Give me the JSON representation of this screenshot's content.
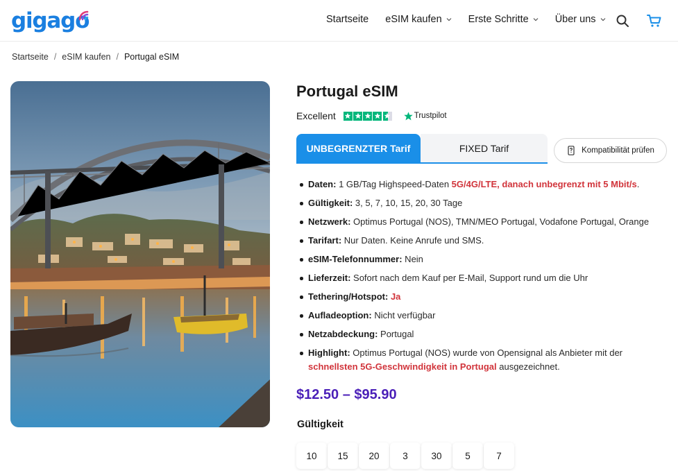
{
  "brand": {
    "logo_text": "gigago",
    "logo_color": "#1a7fe0",
    "logo_arc_colors": [
      "#e23a78",
      "#8a4fd8",
      "#2ea8e8"
    ]
  },
  "nav": {
    "items": [
      {
        "label": "Startseite",
        "has_dropdown": false
      },
      {
        "label": "eSIM kaufen",
        "has_dropdown": true
      },
      {
        "label": "Erste Schritte",
        "has_dropdown": true
      },
      {
        "label": "Über uns",
        "has_dropdown": true
      }
    ],
    "icons": [
      "search-icon",
      "cart-icon"
    ],
    "cart_color": "#1a8fe8"
  },
  "breadcrumb": {
    "items": [
      "Startseite",
      "eSIM kaufen",
      "Portugal eSIM"
    ],
    "separator": "/"
  },
  "product": {
    "image_alt": "Porto bridge at dusk",
    "title": "Portugal eSIM",
    "rating": {
      "word": "Excellent",
      "stars": 4.5,
      "provider": "Trustpilot",
      "star_color": "#00b67a"
    },
    "tabs": [
      {
        "label": "UNBEGRENZTER Tarif",
        "active": true
      },
      {
        "label": "FIXED Tarif",
        "active": false
      }
    ],
    "accent_color": "#1a8fe8",
    "compat_button": "Kompatibilität prüfen",
    "features": [
      {
        "key": "Daten:",
        "value": " 1 GB/Tag Highspeed-Daten ",
        "highlight": "5G/4G/LTE, danach unbegrenzt mit 5 Mbit/s",
        "tail": "."
      },
      {
        "key": "Gültigkeit:",
        "value": " 3, 5, 7, 10, 15, 20, 30 Tage",
        "highlight": "",
        "tail": ""
      },
      {
        "key": "Netzwerk:",
        "value": " Optimus Portugal (NOS), TMN/MEO Portugal, Vodafone Portugal, Orange",
        "highlight": "",
        "tail": ""
      },
      {
        "key": "Tarifart:",
        "value": " Nur Daten. Keine Anrufe und SMS.",
        "highlight": "",
        "tail": ""
      },
      {
        "key": "eSIM-Telefonnummer:",
        "value": " Nein",
        "highlight": "",
        "tail": ""
      },
      {
        "key": "Lieferzeit:",
        "value": " Sofort nach dem Kauf per E-Mail, Support rund um die Uhr",
        "highlight": "",
        "tail": ""
      },
      {
        "key": "Tethering/Hotspot:",
        "value": " ",
        "highlight": "Ja",
        "tail": ""
      },
      {
        "key": "Aufladeoption:",
        "value": " Nicht verfügbar",
        "highlight": "",
        "tail": ""
      },
      {
        "key": "Netzabdeckung:",
        "value": " Portugal",
        "highlight": "",
        "tail": ""
      },
      {
        "key": "Highlight:",
        "value": " Optimus Portugal (NOS) wurde von Opensignal als Anbieter mit der ",
        "highlight": "schnellsten 5G-Geschwindigkeit in Portugal",
        "tail": " ausgezeichnet."
      }
    ],
    "highlight_color": "#d1343b",
    "price": "$12.50 – $95.90",
    "price_color": "#4a1fb8",
    "validity_label": "Gültigkeit",
    "validity_options": [
      "10",
      "15",
      "20",
      "3",
      "30",
      "5",
      "7"
    ]
  }
}
